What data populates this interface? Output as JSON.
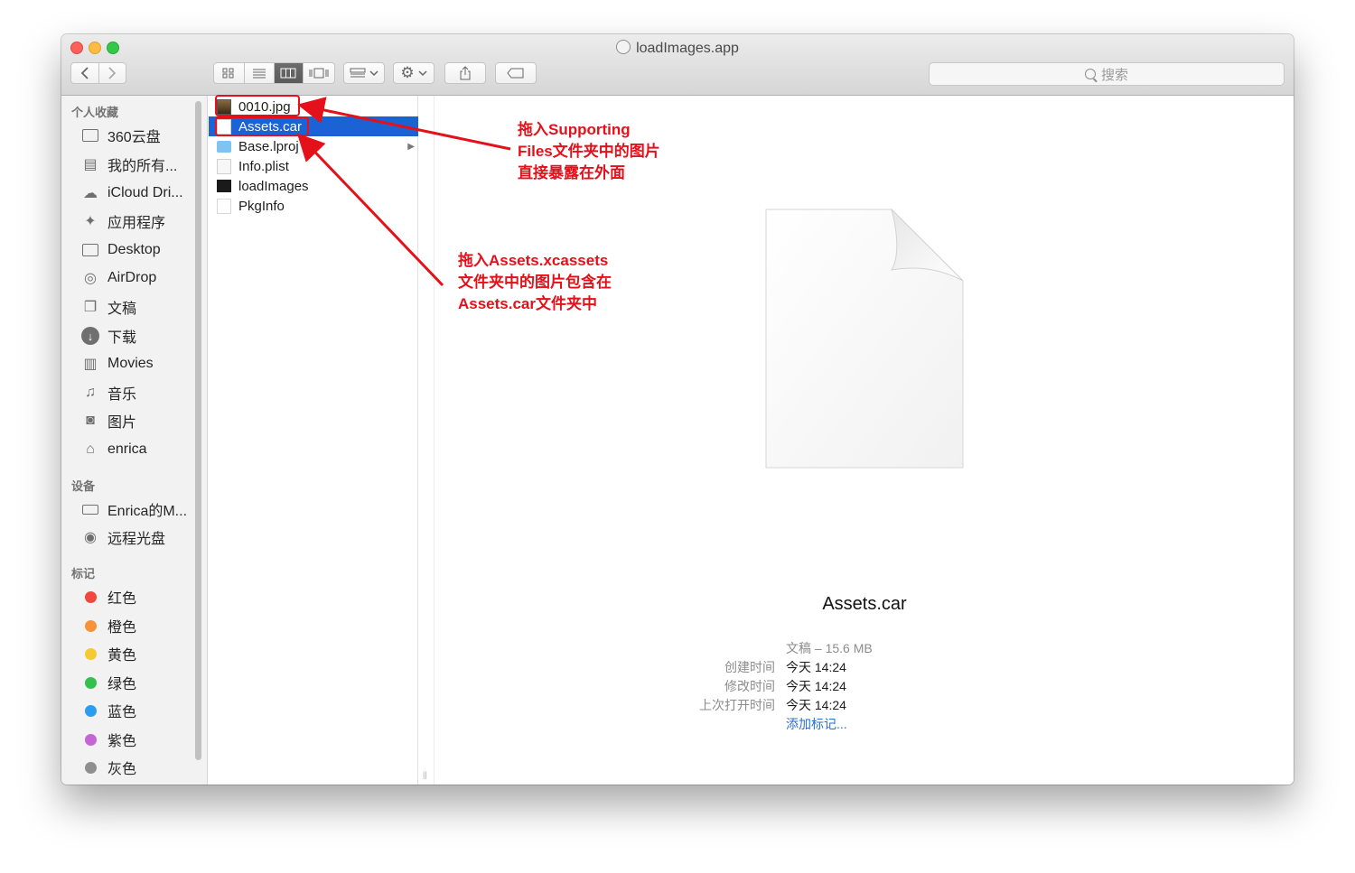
{
  "window": {
    "title": "loadImages.app",
    "search_placeholder": "搜索",
    "toolbar": {
      "view_icons": [
        "grid-view-icon",
        "list-view-icon",
        "column-view-icon",
        "cover-flow-icon"
      ],
      "active_view": "column-view-icon"
    }
  },
  "sidebar": {
    "sections": [
      {
        "heading": "个人收藏",
        "items": [
          {
            "label": "360云盘",
            "icon": "folder-icon"
          },
          {
            "label": "我的所有...",
            "icon": "all-files-icon"
          },
          {
            "label": "iCloud Dri...",
            "icon": "cloud-icon"
          },
          {
            "label": "应用程序",
            "icon": "applications-icon"
          },
          {
            "label": "Desktop",
            "icon": "desktop-icon"
          },
          {
            "label": "AirDrop",
            "icon": "airdrop-icon"
          },
          {
            "label": "文稿",
            "icon": "documents-icon"
          },
          {
            "label": "下载",
            "icon": "downloads-icon"
          },
          {
            "label": "Movies",
            "icon": "film-icon"
          },
          {
            "label": "音乐",
            "icon": "music-icon"
          },
          {
            "label": "图片",
            "icon": "camera-icon"
          },
          {
            "label": "enrica",
            "icon": "home-icon"
          }
        ]
      },
      {
        "heading": "设备",
        "items": [
          {
            "label": "Enrica的M...",
            "icon": "laptop-icon"
          },
          {
            "label": "远程光盘",
            "icon": "disc-icon"
          }
        ]
      },
      {
        "heading": "标记",
        "items": [
          {
            "label": "红色",
            "color": "#f0483e"
          },
          {
            "label": "橙色",
            "color": "#f6923a"
          },
          {
            "label": "黄色",
            "color": "#f7c931"
          },
          {
            "label": "绿色",
            "color": "#33c14b"
          },
          {
            "label": "蓝色",
            "color": "#2c9cf0"
          },
          {
            "label": "紫色",
            "color": "#c465d6"
          },
          {
            "label": "灰色",
            "color": "#8f8f8f"
          }
        ]
      }
    ]
  },
  "files": [
    {
      "name": "0010.jpg",
      "icon": "image-file-icon"
    },
    {
      "name": "Assets.car",
      "icon": "document-file-icon",
      "selected": true
    },
    {
      "name": "Base.lproj",
      "icon": "folder-icon",
      "has_children": true
    },
    {
      "name": "Info.plist",
      "icon": "plist-file-icon"
    },
    {
      "name": "loadImages",
      "icon": "executable-icon"
    },
    {
      "name": "PkgInfo",
      "icon": "document-file-icon"
    }
  ],
  "preview": {
    "name": "Assets.car",
    "kind_size": "文稿 – 15.6 MB",
    "meta": [
      {
        "label": "创建时间",
        "value": "今天 14:24"
      },
      {
        "label": "修改时间",
        "value": "今天 14:24"
      },
      {
        "label": "上次打开时间",
        "value": "今天 14:24"
      }
    ],
    "add_tags": "添加标记..."
  },
  "annotations": {
    "note1": [
      "拖入Supporting",
      "Files文件夹中的图片",
      "直接暴露在外面"
    ],
    "note2": [
      "拖入Assets.xcassets",
      "文件夹中的图片包含在",
      "Assets.car文件夹中"
    ],
    "color": "#e4101a"
  }
}
